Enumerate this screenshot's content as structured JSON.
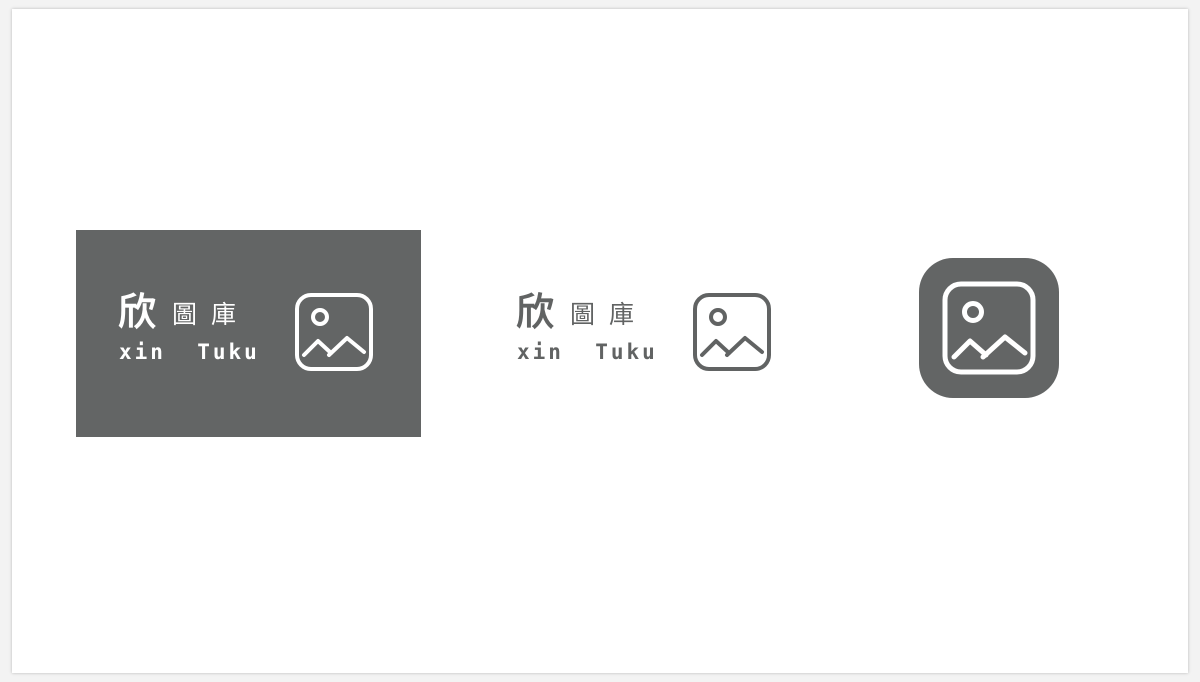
{
  "brand": {
    "name_big": "欣",
    "name_small_1": "圖",
    "name_small_2": "庫",
    "latin": "xin  Tuku"
  },
  "colors": {
    "dark": "#636565",
    "light": "#ffffff",
    "ink": "#616363"
  },
  "icons": {
    "mark": "image-icon"
  }
}
